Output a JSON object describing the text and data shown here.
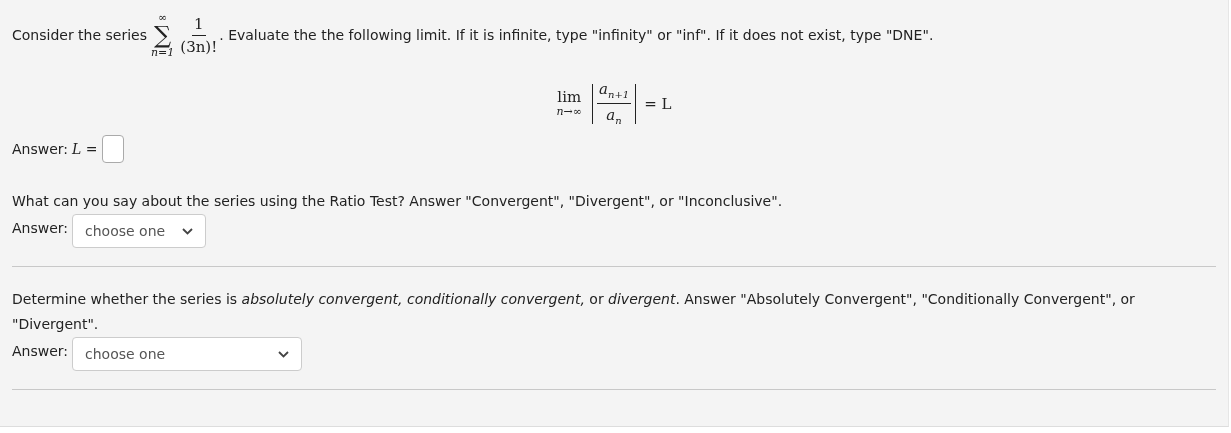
{
  "question_1": {
    "intro": "Consider the series",
    "series": {
      "symbol": "∑",
      "upper": "∞",
      "lower": "n=1",
      "numerator": "1",
      "denominator": "(3n)!"
    },
    "instructions": ". Evaluate the the following limit. If it is infinite, type \"infinity\" or \"inf\". If it does not exist, type \"DNE\".",
    "limit": {
      "operator": "lim",
      "under": "n→∞",
      "numerator_base": "a",
      "numerator_sub": "n+1",
      "denominator_base": "a",
      "denominator_sub": "n",
      "right_side": "= L"
    },
    "answer": {
      "label": "Answer:",
      "math": "L ="
    }
  },
  "question_2": {
    "prompt": "What can you say about the series using the Ratio Test? Answer \"Convergent\", \"Divergent\", or \"Inconclusive\".",
    "answer": {
      "label": "Answer:",
      "selection": "choose one"
    }
  },
  "question_3": {
    "prompt": "Determine whether the series is *absolutely convergent, conditionally convergent,* or *divergent*. Answer \"Absolutely Convergent\", \"Conditionally Convergent\", or \"Divergent\".",
    "answer": {
      "label": "Answer:",
      "selection": "choose one"
    }
  }
}
